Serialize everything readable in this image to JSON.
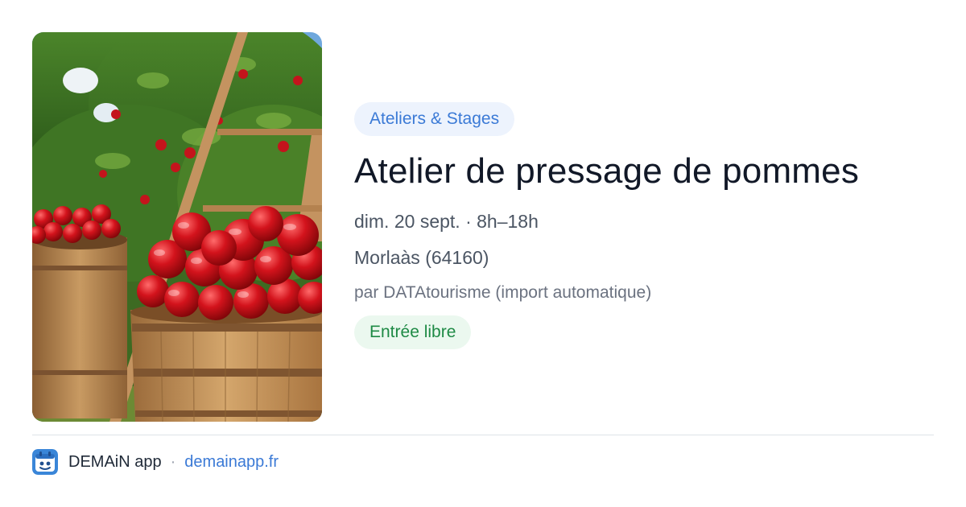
{
  "event": {
    "category": "Ateliers & Stages",
    "title": "Atelier de pressage de pommes",
    "date": "dim. 20 sept. · 8h–18h",
    "location": "Morlaàs (64160)",
    "source": "par DATAtourisme (import automatique)",
    "price": "Entrée libre"
  },
  "footer": {
    "app_name": "DEMAiN app",
    "separator": "·",
    "url": "demainapp.fr"
  },
  "icons": {
    "app_logo": "demain-app-logo-icon"
  },
  "colors": {
    "category_badge_bg": "#edf3fd",
    "category_badge_text": "#3b7ad6",
    "price_badge_bg": "#ebf8ef",
    "price_badge_text": "#1e8a45",
    "link": "#3b7ad6",
    "title": "#111827"
  }
}
